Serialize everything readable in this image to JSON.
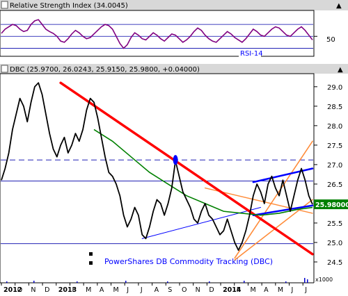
{
  "rsi_panel": {
    "title": "Relative Strength Index (34.0045)",
    "badge": "RSI-14",
    "y_tick_50": "50"
  },
  "price_panel": {
    "header": "DBC (25.9700, 26.0243, 25.9150, 25.9800, +0.04000)",
    "legend": "PowerShares DB Commodity Tracking (DBC)",
    "last_price_label": "25.98000",
    "volume_unit_label": "x1000"
  },
  "colors": {
    "price": "#000000",
    "rsi": "#800080",
    "moving_average": "#008000",
    "downtrend": "#ff0000",
    "channel": "#0000ff",
    "orange_channel": "#ff8c3a",
    "last_price_bg": "#008000",
    "panel_header_bg": "#d8d8d8",
    "frame": "#000000"
  },
  "chart_data": [
    {
      "type": "line",
      "name": "rsi",
      "ylim": [
        20,
        90
      ],
      "reference_levels": [
        30,
        50,
        70
      ],
      "y_ticks": [
        "50"
      ],
      "points": [
        [
          0,
          55
        ],
        [
          1,
          62
        ],
        [
          2,
          66
        ],
        [
          3,
          70
        ],
        [
          4,
          68
        ],
        [
          5,
          62
        ],
        [
          6,
          58
        ],
        [
          7,
          60
        ],
        [
          8,
          70
        ],
        [
          9,
          76
        ],
        [
          10,
          78
        ],
        [
          11,
          70
        ],
        [
          12,
          62
        ],
        [
          13,
          58
        ],
        [
          14,
          55
        ],
        [
          15,
          50
        ],
        [
          16,
          42
        ],
        [
          17,
          40
        ],
        [
          18,
          46
        ],
        [
          19,
          54
        ],
        [
          20,
          60
        ],
        [
          21,
          56
        ],
        [
          22,
          50
        ],
        [
          23,
          46
        ],
        [
          24,
          48
        ],
        [
          25,
          54
        ],
        [
          26,
          60
        ],
        [
          27,
          66
        ],
        [
          28,
          70
        ],
        [
          29,
          68
        ],
        [
          30,
          62
        ],
        [
          31,
          50
        ],
        [
          32,
          38
        ],
        [
          33,
          30
        ],
        [
          34,
          36
        ],
        [
          35,
          48
        ],
        [
          36,
          56
        ],
        [
          37,
          52
        ],
        [
          38,
          46
        ],
        [
          39,
          44
        ],
        [
          40,
          50
        ],
        [
          41,
          56
        ],
        [
          42,
          52
        ],
        [
          43,
          46
        ],
        [
          44,
          42
        ],
        [
          45,
          48
        ],
        [
          46,
          54
        ],
        [
          47,
          52
        ],
        [
          48,
          46
        ],
        [
          49,
          40
        ],
        [
          50,
          44
        ],
        [
          51,
          50
        ],
        [
          52,
          58
        ],
        [
          53,
          64
        ],
        [
          54,
          60
        ],
        [
          55,
          52
        ],
        [
          56,
          46
        ],
        [
          57,
          42
        ],
        [
          58,
          40
        ],
        [
          59,
          46
        ],
        [
          60,
          52
        ],
        [
          61,
          58
        ],
        [
          62,
          54
        ],
        [
          63,
          48
        ],
        [
          64,
          44
        ],
        [
          65,
          40
        ],
        [
          66,
          46
        ],
        [
          67,
          54
        ],
        [
          68,
          62
        ],
        [
          69,
          58
        ],
        [
          70,
          52
        ],
        [
          71,
          50
        ],
        [
          72,
          56
        ],
        [
          73,
          62
        ],
        [
          74,
          66
        ],
        [
          75,
          64
        ],
        [
          76,
          58
        ],
        [
          77,
          52
        ],
        [
          78,
          50
        ],
        [
          79,
          56
        ],
        [
          80,
          62
        ],
        [
          81,
          66
        ],
        [
          82,
          60
        ],
        [
          83,
          52
        ],
        [
          84,
          44
        ]
      ]
    },
    {
      "type": "line",
      "name": "price",
      "ylim": [
        24.0,
        29.3
      ],
      "y_ticks": [
        "24.5",
        "25.0",
        "25.5",
        "26.0",
        "26.5",
        "27.0",
        "27.5",
        "28.0",
        "28.5",
        "29.0"
      ],
      "reference_levels": [
        24.97,
        26.58,
        27.12
      ],
      "x_labels": [
        "2012",
        "O",
        "N",
        "D",
        "2013",
        "F",
        "M",
        "A",
        "M",
        "J",
        "J",
        "A",
        "S",
        "O",
        "N",
        "D",
        "2014",
        "F",
        "M",
        "A",
        "M",
        "J",
        "J"
      ],
      "last_value": 25.98,
      "points": [
        [
          0,
          26.6
        ],
        [
          1,
          26.9
        ],
        [
          2,
          27.3
        ],
        [
          3,
          27.9
        ],
        [
          4,
          28.3
        ],
        [
          5,
          28.7
        ],
        [
          6,
          28.5
        ],
        [
          7,
          28.1
        ],
        [
          8,
          28.6
        ],
        [
          9,
          29.0
        ],
        [
          10,
          29.1
        ],
        [
          11,
          28.8
        ],
        [
          12,
          28.3
        ],
        [
          13,
          27.8
        ],
        [
          14,
          27.4
        ],
        [
          15,
          27.2
        ],
        [
          16,
          27.5
        ],
        [
          17,
          27.7
        ],
        [
          18,
          27.3
        ],
        [
          19,
          27.5
        ],
        [
          20,
          27.8
        ],
        [
          21,
          27.6
        ],
        [
          22,
          27.9
        ],
        [
          23,
          28.4
        ],
        [
          24,
          28.7
        ],
        [
          25,
          28.6
        ],
        [
          26,
          28.2
        ],
        [
          27,
          27.7
        ],
        [
          28,
          27.2
        ],
        [
          29,
          26.8
        ],
        [
          30,
          26.7
        ],
        [
          31,
          26.5
        ],
        [
          32,
          26.2
        ],
        [
          33,
          25.7
        ],
        [
          34,
          25.4
        ],
        [
          35,
          25.6
        ],
        [
          36,
          25.9
        ],
        [
          37,
          25.7
        ],
        [
          38,
          25.2
        ],
        [
          39,
          25.1
        ],
        [
          40,
          25.4
        ],
        [
          41,
          25.8
        ],
        [
          42,
          26.1
        ],
        [
          43,
          26.0
        ],
        [
          44,
          25.7
        ],
        [
          45,
          26.0
        ],
        [
          46,
          26.4
        ],
        [
          47,
          27.1
        ],
        [
          48,
          26.7
        ],
        [
          49,
          26.3
        ],
        [
          50,
          26.1
        ],
        [
          51,
          25.9
        ],
        [
          52,
          25.6
        ],
        [
          53,
          25.5
        ],
        [
          54,
          25.8
        ],
        [
          55,
          26.0
        ],
        [
          56,
          25.7
        ],
        [
          57,
          25.6
        ],
        [
          58,
          25.4
        ],
        [
          59,
          25.2
        ],
        [
          60,
          25.3
        ],
        [
          61,
          25.6
        ],
        [
          62,
          25.3
        ],
        [
          63,
          25.0
        ],
        [
          64,
          24.8
        ],
        [
          65,
          25.0
        ],
        [
          66,
          25.3
        ],
        [
          67,
          25.7
        ],
        [
          68,
          26.2
        ],
        [
          69,
          26.5
        ],
        [
          70,
          26.3
        ],
        [
          71,
          26.0
        ],
        [
          72,
          26.5
        ],
        [
          73,
          26.7
        ],
        [
          74,
          26.4
        ],
        [
          75,
          26.2
        ],
        [
          76,
          26.6
        ],
        [
          77,
          26.2
        ],
        [
          78,
          25.8
        ],
        [
          79,
          26.2
        ],
        [
          80,
          26.6
        ],
        [
          81,
          26.9
        ],
        [
          82,
          26.6
        ],
        [
          83,
          26.2
        ],
        [
          84,
          25.98
        ]
      ],
      "moving_average": [
        [
          25,
          27.9
        ],
        [
          30,
          27.6
        ],
        [
          35,
          27.2
        ],
        [
          40,
          26.8
        ],
        [
          45,
          26.5
        ],
        [
          50,
          26.2
        ],
        [
          55,
          26.0
        ],
        [
          60,
          25.8
        ],
        [
          65,
          25.75
        ],
        [
          70,
          25.7
        ],
        [
          75,
          25.75
        ],
        [
          80,
          25.85
        ],
        [
          84,
          25.9
        ]
      ],
      "trendlines": {
        "downtrend": [
          [
            16,
            29.1
          ],
          [
            84,
            24.7
          ]
        ],
        "support": [
          [
            38,
            25.1
          ],
          [
            70,
            25.9
          ]
        ],
        "channel_upper": [
          [
            68,
            26.55
          ],
          [
            84,
            26.9
          ]
        ],
        "channel_lower": [
          [
            68,
            25.7
          ],
          [
            84,
            25.95
          ]
        ],
        "orange_upper": [
          [
            63,
            24.6
          ],
          [
            84,
            27.6
          ]
        ],
        "orange_lower": [
          [
            63,
            24.55
          ],
          [
            84,
            26.1
          ]
        ],
        "orange_mid": [
          [
            55,
            26.4
          ],
          [
            84,
            25.75
          ]
        ]
      },
      "highlight_point": [
        47,
        27.12
      ]
    }
  ]
}
